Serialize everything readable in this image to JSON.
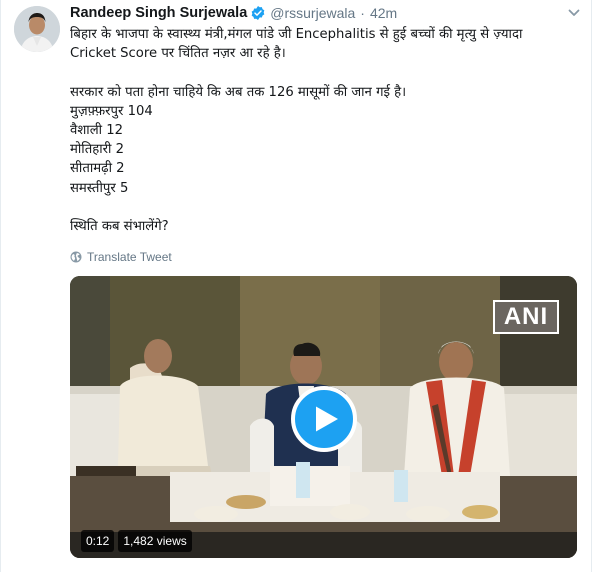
{
  "author": {
    "display_name": "Randeep Singh Surjewala",
    "handle": "@rssurjewala",
    "separator": "·",
    "time": "42m"
  },
  "tweet": {
    "lines": [
      "बिहार के भाजपा के स्वास्थ्य मंत्री,मंगल पांडे जी Encephalitis से हुई बच्चों की मृत्यु से ज़्यादा",
      "Cricket Score पर चिंतित नज़र आ रहे है।",
      "",
      "सरकार को पता होना चाहिये कि अब तक 126 मासूमों की जान गई है।",
      "मुज़फ़्फ़रपुर 104",
      "वैशाली 12",
      "मोतिहारी 2",
      "सीतामढ़ी 2",
      "समस्तीपुर 5",
      "",
      "स्थिति कब संभालेंगे?"
    ]
  },
  "translate_label": "Translate Tweet",
  "video": {
    "watermark": "ANI",
    "duration": "0:12",
    "views": "1,482 views"
  },
  "icons": {
    "verified": "verified-badge-icon",
    "more": "chevron-down-icon",
    "translate": "globe-icon",
    "play": "play-icon"
  },
  "colors": {
    "accent": "#1da1f2",
    "text": "#14171a",
    "muted": "#657786"
  }
}
